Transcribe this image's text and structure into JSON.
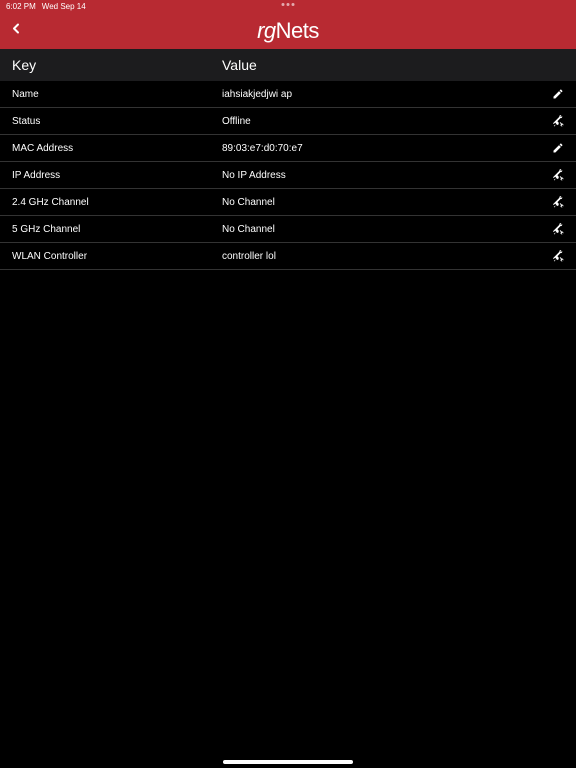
{
  "statusBar": {
    "time": "6:02 PM",
    "date": "Wed Sep 14"
  },
  "header": {
    "logoRg": "rg",
    "logoNets": "Nets"
  },
  "tableHeader": {
    "key": "Key",
    "value": "Value"
  },
  "rows": [
    {
      "key": "Name",
      "value": "iahsiakjedjwi ap",
      "icon": "edit"
    },
    {
      "key": "Status",
      "value": "Offline",
      "icon": "tools"
    },
    {
      "key": "MAC Address",
      "value": "89:03:e7:d0:70:e7",
      "icon": "edit"
    },
    {
      "key": "IP Address",
      "value": "No IP Address",
      "icon": "tools"
    },
    {
      "key": "2.4 GHz Channel",
      "value": "No Channel",
      "icon": "tools"
    },
    {
      "key": "5 GHz Channel",
      "value": "No Channel",
      "icon": "tools"
    },
    {
      "key": "WLAN Controller",
      "value": "controller lol",
      "icon": "tools"
    }
  ]
}
